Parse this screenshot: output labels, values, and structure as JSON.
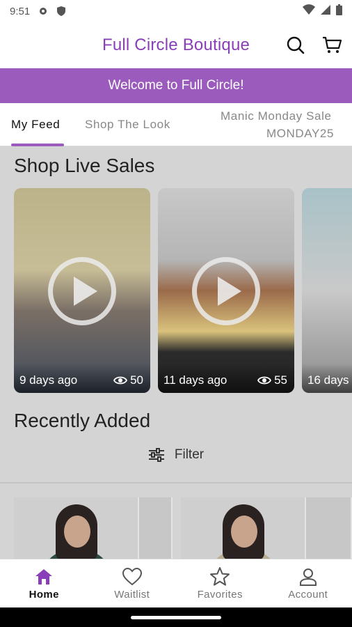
{
  "status": {
    "time": "9:51"
  },
  "header": {
    "title": "Full Circle Boutique"
  },
  "banner": {
    "text": "Welcome to Full Circle!"
  },
  "tabs": [
    {
      "label": "My Feed",
      "active": true
    },
    {
      "label": "Shop The Look"
    },
    {
      "label": "Manic Monday Sale",
      "code": "MONDAY25"
    }
  ],
  "live": {
    "title": "Shop Live Sales",
    "videos": [
      {
        "ago": "9 days ago",
        "views": "50"
      },
      {
        "ago": "11 days ago",
        "views": "55"
      },
      {
        "ago": "16 days"
      }
    ]
  },
  "recent": {
    "title": "Recently Added",
    "filter_label": "Filter"
  },
  "nav": [
    {
      "label": "Home",
      "icon": "home-icon",
      "active": true
    },
    {
      "label": "Waitlist",
      "icon": "heart-icon"
    },
    {
      "label": "Favorites",
      "icon": "star-icon"
    },
    {
      "label": "Account",
      "icon": "person-icon"
    }
  ],
  "colors": {
    "brand": "#8a3fb8",
    "banner": "#9a5bbd"
  }
}
